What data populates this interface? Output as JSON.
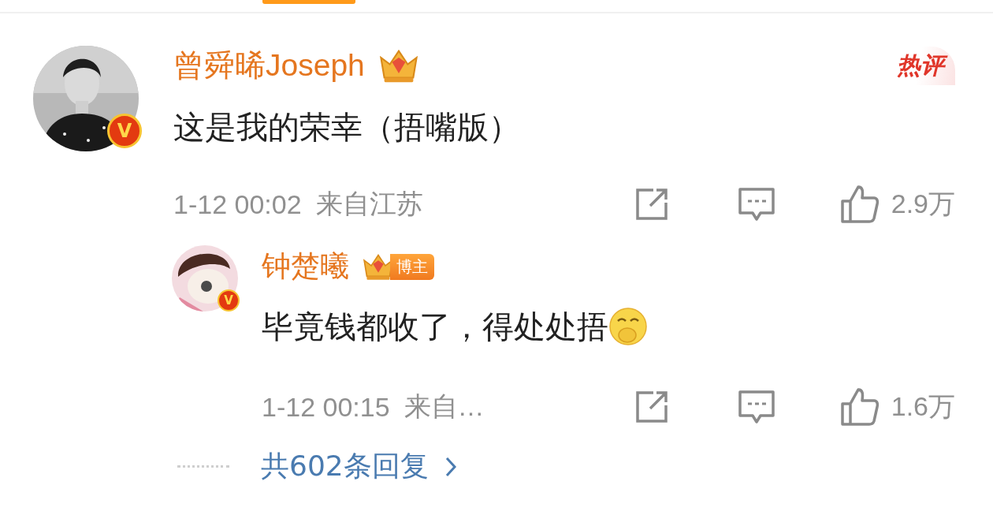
{
  "comment": {
    "author": "曾舜晞Joseph",
    "verified": true,
    "verified_mark": "V",
    "badge": {
      "kind": "crown"
    },
    "hot_label": "热评",
    "text": "这是我的荣幸（捂嘴版）",
    "time": "1-12 00:02",
    "location": "来自江苏",
    "likes": "2.9万",
    "reply": {
      "author": "钟楚曦",
      "verified": true,
      "verified_mark": "V",
      "badge": {
        "kind": "crown-label",
        "label": "博主"
      },
      "text": "毕竟钱都收了，得处处捂",
      "trailing_emoji": true,
      "time": "1-12 00:15",
      "location": "来自…",
      "likes": "1.6万"
    },
    "more_replies": "共602条回复"
  }
}
